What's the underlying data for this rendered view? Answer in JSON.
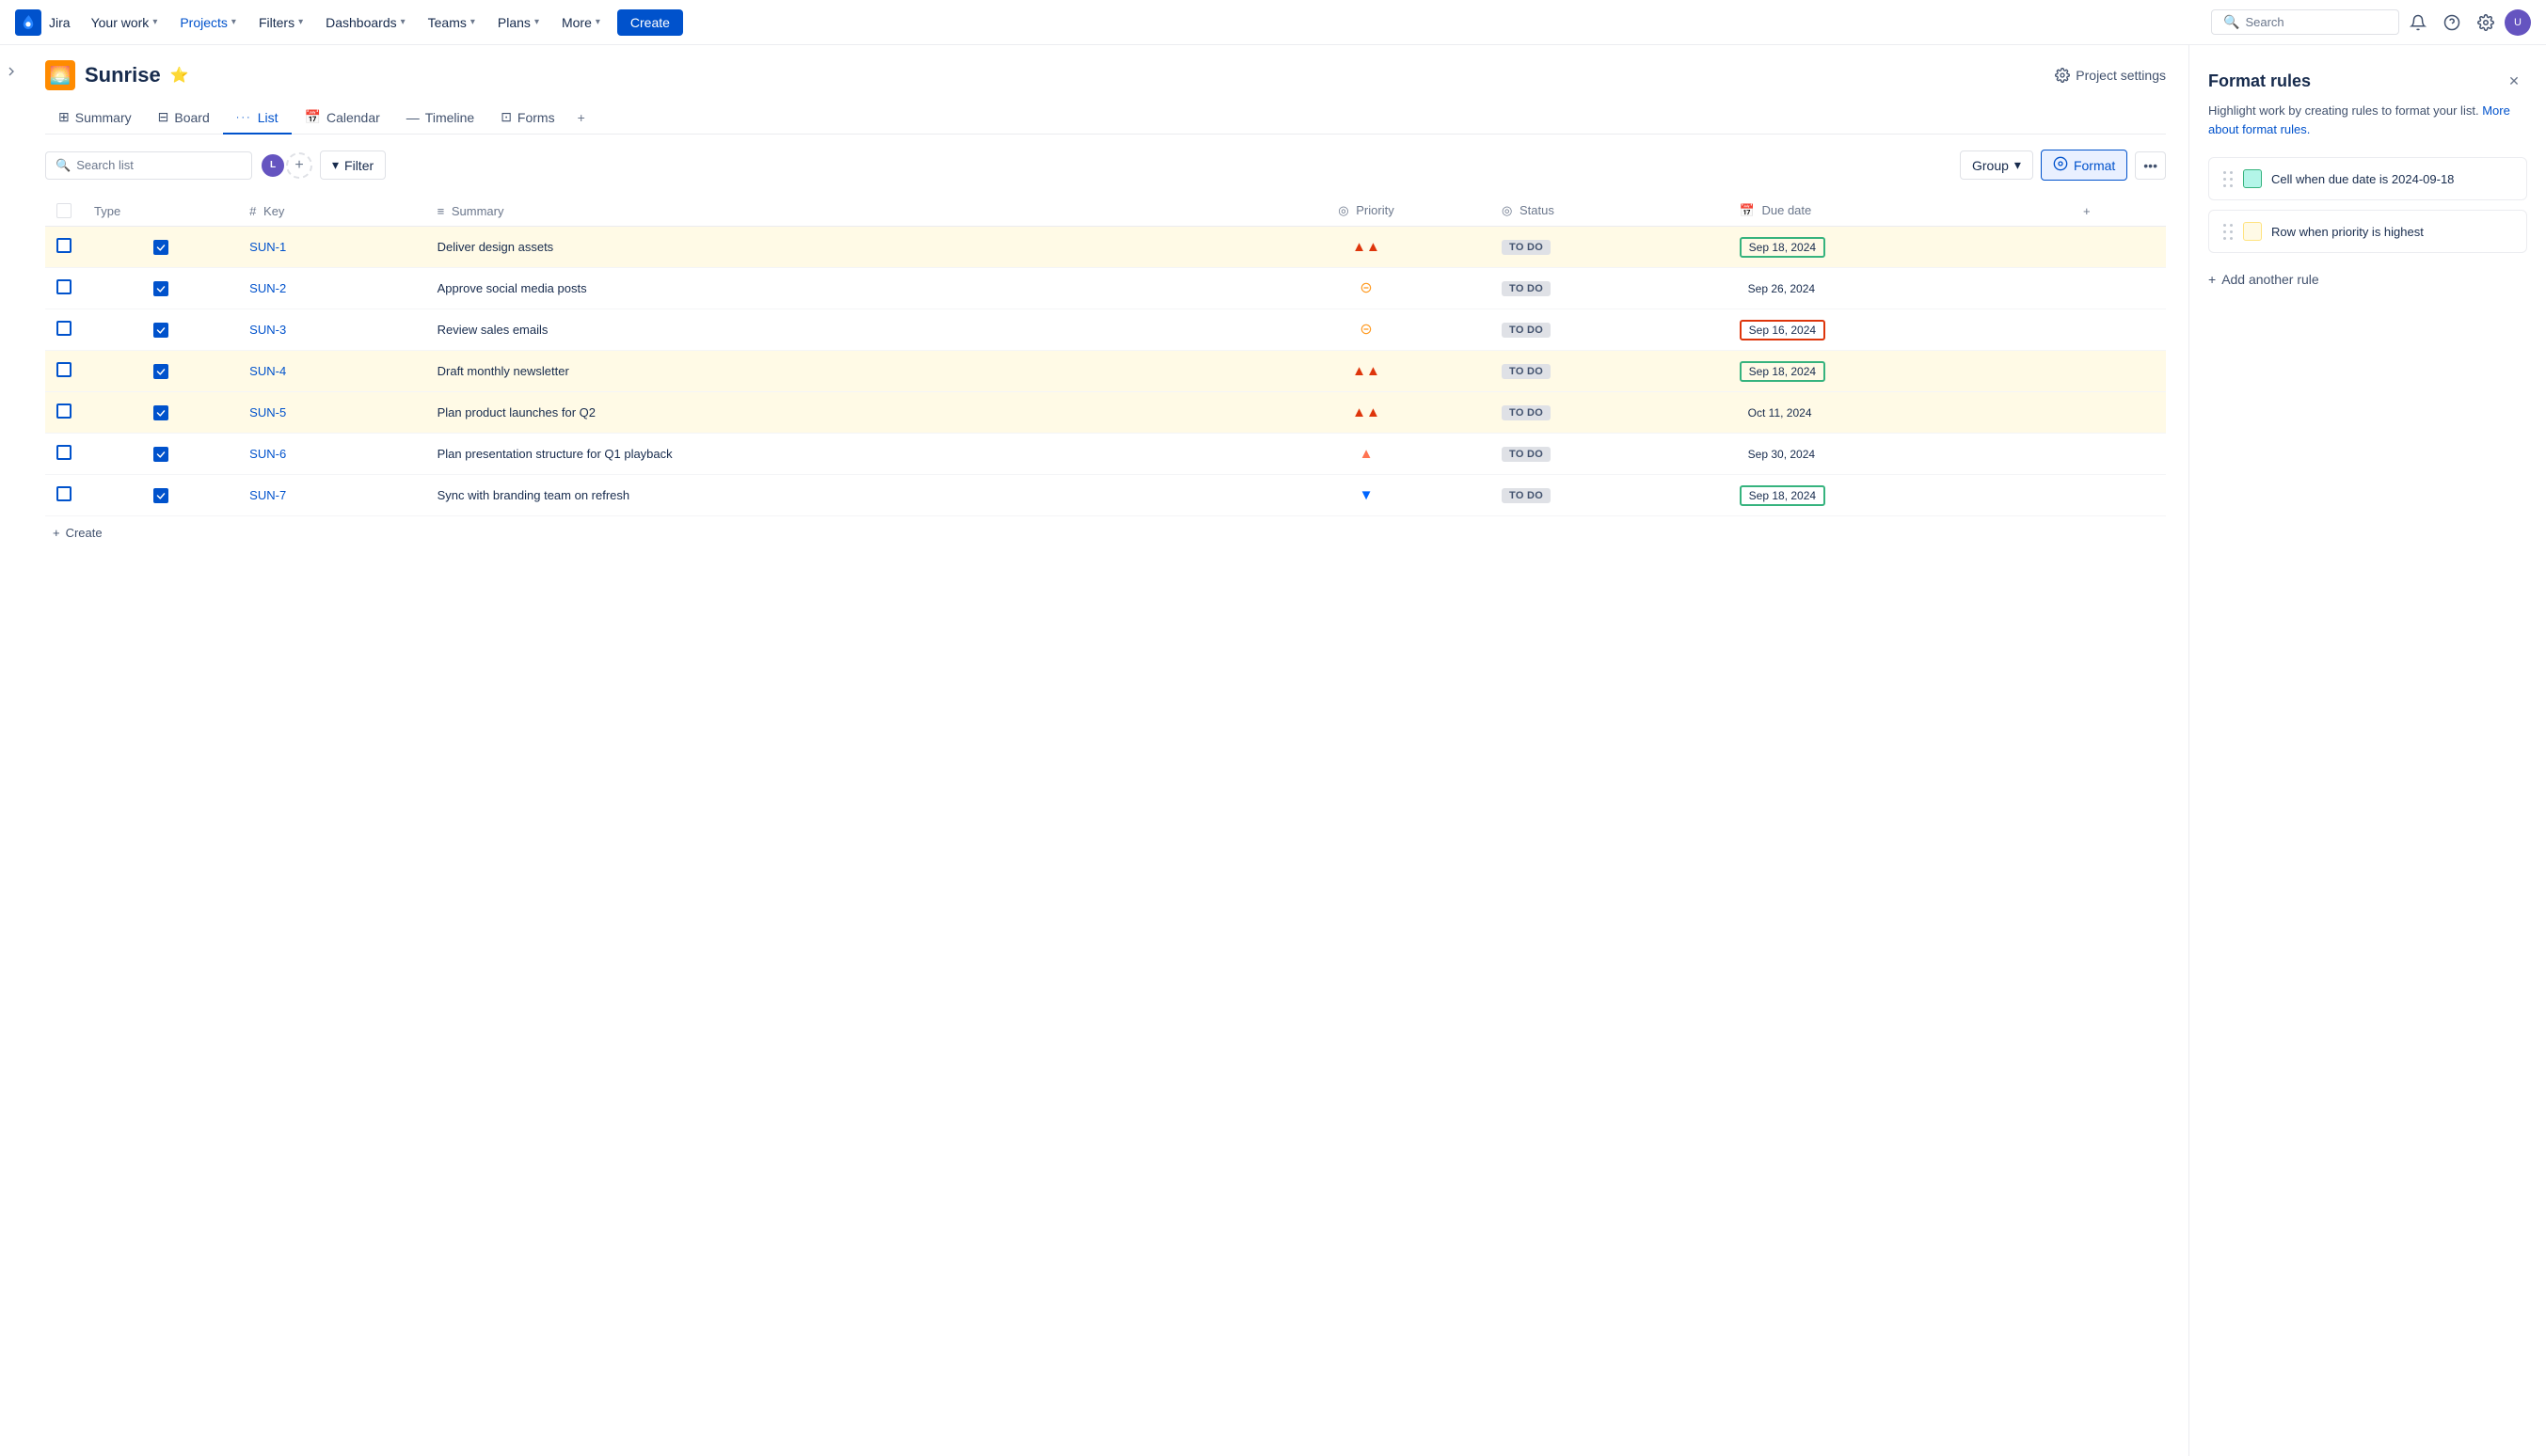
{
  "topnav": {
    "logo_text": "Jira",
    "items": [
      {
        "label": "Your work",
        "has_chevron": true,
        "active": false
      },
      {
        "label": "Projects",
        "has_chevron": true,
        "active": true
      },
      {
        "label": "Filters",
        "has_chevron": true,
        "active": false
      },
      {
        "label": "Dashboards",
        "has_chevron": true,
        "active": false
      },
      {
        "label": "Teams",
        "has_chevron": true,
        "active": false
      },
      {
        "label": "Plans",
        "has_chevron": true,
        "active": false
      },
      {
        "label": "More",
        "has_chevron": true,
        "active": false
      }
    ],
    "create_label": "Create",
    "search_placeholder": "Search"
  },
  "project": {
    "name": "Sunrise",
    "icon": "🌅",
    "settings_label": "Project settings"
  },
  "tabs": [
    {
      "id": "summary",
      "label": "Summary",
      "icon": "⊞",
      "active": false
    },
    {
      "id": "board",
      "label": "Board",
      "icon": "⊟",
      "active": false
    },
    {
      "id": "list",
      "label": "List",
      "icon": "···",
      "active": true
    },
    {
      "id": "calendar",
      "label": "Calendar",
      "icon": "📅",
      "active": false
    },
    {
      "id": "timeline",
      "label": "Timeline",
      "icon": "—",
      "active": false
    },
    {
      "id": "forms",
      "label": "Forms",
      "icon": "⊡",
      "active": false
    }
  ],
  "toolbar": {
    "search_placeholder": "Search list",
    "filter_label": "Filter",
    "group_label": "Group",
    "format_label": "Format"
  },
  "table": {
    "columns": [
      "Type",
      "Key",
      "Summary",
      "Priority",
      "Status",
      "Due date"
    ],
    "rows": [
      {
        "id": 1,
        "key": "SUN-1",
        "summary": "Deliver design assets",
        "priority": "highest",
        "priority_icon": "▲▲",
        "status": "TO DO",
        "due_date": "Sep 18, 2024",
        "highlight_row": true,
        "highlight_date": "teal"
      },
      {
        "id": 2,
        "key": "SUN-2",
        "summary": "Approve social media posts",
        "priority": "medium",
        "priority_icon": "⊖",
        "status": "TO DO",
        "due_date": "Sep 26, 2024",
        "highlight_row": false,
        "highlight_date": null
      },
      {
        "id": 3,
        "key": "SUN-3",
        "summary": "Review sales emails",
        "priority": "medium",
        "priority_icon": "≡",
        "status": "TO DO",
        "due_date": "Sep 16, 2024",
        "highlight_row": false,
        "highlight_date": "red"
      },
      {
        "id": 4,
        "key": "SUN-4",
        "summary": "Draft monthly newsletter",
        "priority": "highest",
        "priority_icon": "▲▲",
        "status": "TO DO",
        "due_date": "Sep 18, 2024",
        "highlight_row": true,
        "highlight_date": "teal"
      },
      {
        "id": 5,
        "key": "SUN-5",
        "summary": "Plan product launches for Q2",
        "priority": "highest",
        "priority_icon": "▲▲",
        "status": "TO DO",
        "due_date": "Oct 11, 2024",
        "highlight_row": true,
        "highlight_date": null
      },
      {
        "id": 6,
        "key": "SUN-6",
        "summary": "Plan presentation structure for Q1 playback",
        "priority": "high",
        "priority_icon": "▲",
        "status": "TO DO",
        "due_date": "Sep 30, 2024",
        "highlight_row": false,
        "highlight_date": null
      },
      {
        "id": 7,
        "key": "SUN-7",
        "summary": "Sync with branding team on refresh",
        "priority": "lowest",
        "priority_icon": "▼",
        "status": "TO DO",
        "due_date": "Sep 18, 2024",
        "highlight_row": false,
        "highlight_date": "teal"
      }
    ]
  },
  "format_panel": {
    "title": "Format rules",
    "description": "Highlight work by creating rules to format your list.",
    "link_text": "More about format rules.",
    "rules": [
      {
        "id": 1,
        "label": "Cell when due date is 2024-09-18",
        "color": "#b3f5e8",
        "color_border": "#36b37e"
      },
      {
        "id": 2,
        "label": "Row when priority is highest",
        "color": "#fffae6",
        "color_border": "#ffe380"
      }
    ],
    "add_rule_label": "Add another rule"
  },
  "create_label": "Create"
}
